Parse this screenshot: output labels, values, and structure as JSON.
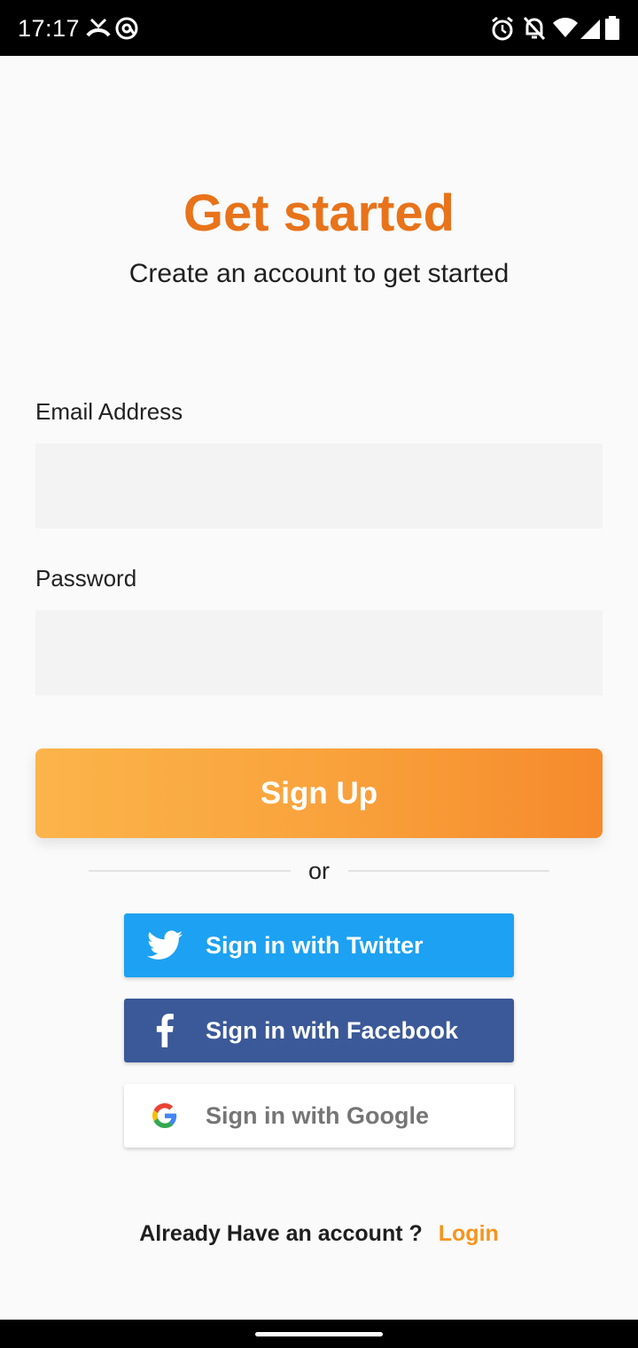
{
  "status_bar": {
    "time": "17:17",
    "icons": [
      "missed-call-icon",
      "at-sign-icon",
      "alarm-icon",
      "notifications-off-icon",
      "wifi-icon",
      "signal-icon",
      "battery-icon"
    ]
  },
  "header": {
    "title": "Get started",
    "subtitle": "Create an account to get started"
  },
  "form": {
    "email_label": "Email Address",
    "email_value": "",
    "password_label": "Password",
    "password_value": ""
  },
  "signup": {
    "label": "Sign Up"
  },
  "divider": {
    "text": "or"
  },
  "social": {
    "twitter_label": "Sign in with Twitter",
    "facebook_label": "Sign in with Facebook",
    "google_label": "Sign in with Google"
  },
  "footer": {
    "question": "Already Have an account ?",
    "login_label": "Login"
  },
  "colors": {
    "accent": "#e8731a",
    "gradient_start": "#fcb44a",
    "gradient_end": "#f68a2c",
    "twitter": "#1da1f2",
    "facebook": "#3b5998",
    "login_link": "#f7941d"
  }
}
